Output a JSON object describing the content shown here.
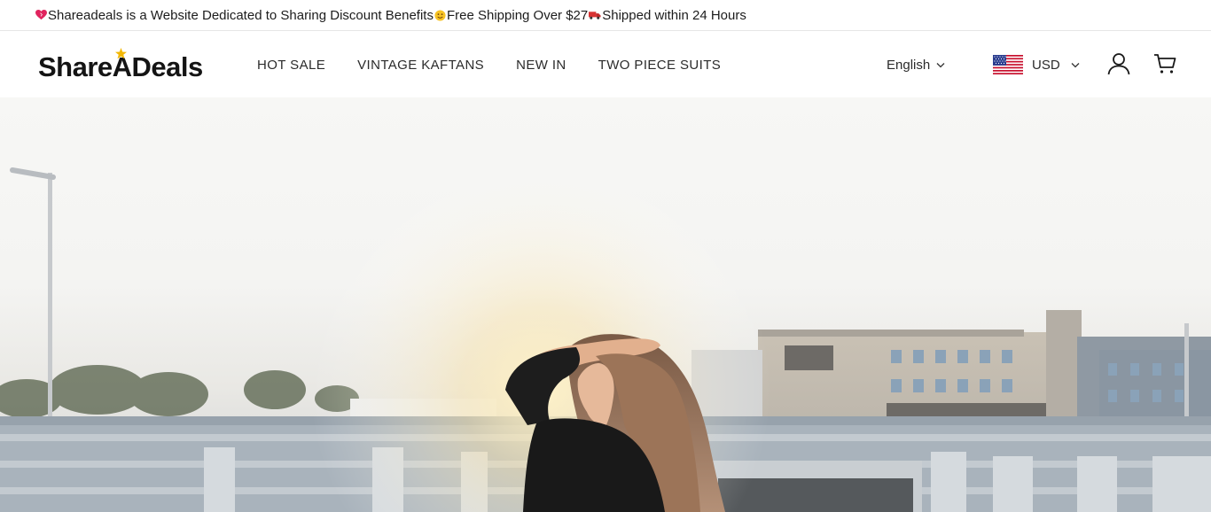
{
  "announcement": {
    "part1": "Shareadeals is a Website Dedicated to Sharing Discount Benefits",
    "part2": "Free Shipping Over $27",
    "part3": "Shipped within 24 Hours",
    "icons": [
      "heart-icon",
      "smile-icon",
      "truck-icon"
    ]
  },
  "header": {
    "logo_text": "ShareADeals",
    "nav": [
      {
        "label": "HOT SALE"
      },
      {
        "label": "VINTAGE KAFTANS"
      },
      {
        "label": "NEW IN"
      },
      {
        "label": "TWO PIECE SUITS"
      }
    ],
    "language": "English",
    "currency": "USD",
    "icons": {
      "flag": "us-flag-icon",
      "account": "user-icon",
      "cart": "cart-icon"
    }
  },
  "hero": {
    "image": "woman with hand in hair on rooftop at sunset, city buildings in background"
  },
  "colors": {
    "text": "#1c1c1c",
    "border": "#e6e6e6",
    "accent_star": "#f2b705"
  }
}
